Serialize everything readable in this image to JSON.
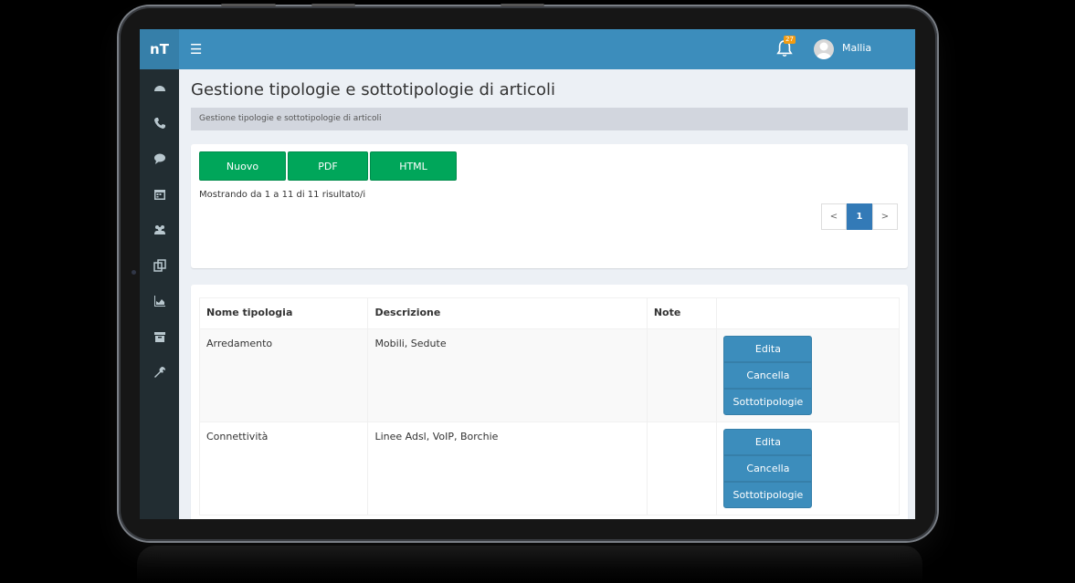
{
  "brand": "nT",
  "header": {
    "menu_icon": "menu-icon",
    "notification_count": "27",
    "user_name": "Mallia"
  },
  "sidebar": {
    "items": [
      {
        "icon": "dashboard-icon"
      },
      {
        "icon": "phone-icon"
      },
      {
        "icon": "comment-icon"
      },
      {
        "icon": "calendar-icon"
      },
      {
        "icon": "users-icon"
      },
      {
        "icon": "copy-icon"
      },
      {
        "icon": "area-chart-icon"
      },
      {
        "icon": "archive-icon"
      },
      {
        "icon": "wrench-icon"
      }
    ]
  },
  "page": {
    "title": "Gestione tipologie e sottotipologie di articoli",
    "breadcrumb": "Gestione tipologie e sottotipologie di articoli"
  },
  "toolbar": {
    "new_label": "Nuovo",
    "pdf_label": "PDF",
    "html_label": "HTML"
  },
  "results_text": "Mostrando da 1 a 11 di 11 risultato/i",
  "pagination": {
    "prev": "<",
    "current": "1",
    "next": ">"
  },
  "table": {
    "headers": [
      "Nome tipologia",
      "Descrizione",
      "Note",
      ""
    ],
    "rows": [
      {
        "name": "Arredamento",
        "description": "Mobili, Sedute",
        "note": ""
      },
      {
        "name": "Connettività",
        "description": "Linee Adsl, VoIP, Borchie",
        "note": ""
      }
    ],
    "actions": {
      "edit": "Edita",
      "delete": "Cancella",
      "subtypes": "Sottotipologie"
    }
  },
  "colors": {
    "header": "#3c8dbc",
    "brand": "#367fa9",
    "sidebar": "#222d32",
    "green": "#00a65a"
  }
}
